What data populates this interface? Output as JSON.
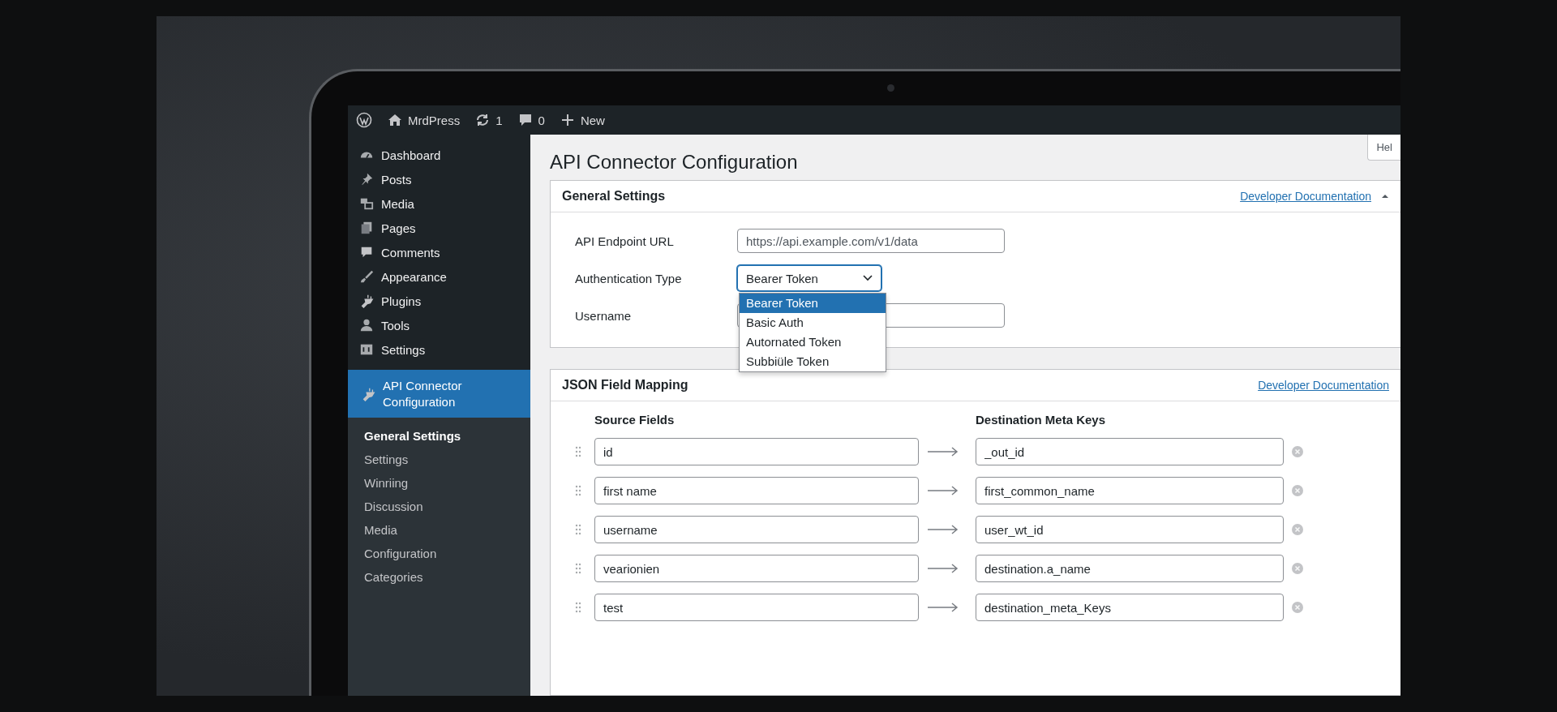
{
  "admin_bar": {
    "items": [
      {
        "kind": "logo"
      },
      {
        "kind": "home",
        "label": "MrdPress"
      },
      {
        "kind": "updates",
        "label": "1"
      },
      {
        "kind": "comments",
        "label": "0"
      },
      {
        "kind": "new",
        "label": "New"
      }
    ]
  },
  "sidebar": {
    "items": [
      {
        "kind": "dashboard",
        "label": "Dashboard",
        "selected": false
      },
      {
        "kind": "posts",
        "label": "Posts",
        "selected": false
      },
      {
        "kind": "media",
        "label": "Media",
        "selected": false
      },
      {
        "kind": "pages",
        "label": "Pages",
        "selected": false
      },
      {
        "kind": "comments",
        "label": "Comments",
        "selected": false
      },
      {
        "kind": "appearance",
        "label": "Appearance",
        "selected": false
      },
      {
        "kind": "plugins",
        "label": "Plugins",
        "selected": false
      },
      {
        "kind": "tools",
        "label": "Tools",
        "selected": false
      },
      {
        "kind": "settings",
        "label": "Settings",
        "selected": false
      },
      {
        "kind": "plugin",
        "label": "API Connector Configuration",
        "selected": true
      }
    ],
    "submenu": [
      {
        "label": "General Settings",
        "selected": true
      },
      {
        "label": "Settings",
        "selected": false
      },
      {
        "label": "Winriing",
        "selected": false
      },
      {
        "label": "Discussion",
        "selected": false
      },
      {
        "label": "Media",
        "selected": false
      },
      {
        "label": "Configuration",
        "selected": false
      },
      {
        "label": "Categories",
        "selected": false
      }
    ]
  },
  "page": {
    "title": "API Connector Configuration",
    "help_tab": "Hel"
  },
  "general_settings": {
    "title": "General Settings",
    "link": "Developer Documentation",
    "fields": [
      {
        "kind": "text",
        "label": "API Endpoint URL",
        "placeholder": "https://api.example.com/v1/data"
      },
      {
        "kind": "select",
        "label": "Authentication Type",
        "value": "Bearer Token",
        "expanded": true,
        "options": [
          {
            "label": "Bearer Token",
            "selected": true
          },
          {
            "label": "Basic Auth",
            "selected": false
          },
          {
            "label": "Autornated Token",
            "selected": false
          },
          {
            "label": "Subbiüle Token",
            "selected": false
          }
        ]
      },
      {
        "kind": "text",
        "label": "Username"
      }
    ]
  },
  "field_mapping": {
    "title": "JSON Field Mapping",
    "link": "Developer Documentation",
    "source_heading": "Source Fields",
    "destination_heading": "Destination Meta Keys",
    "rows": [
      {
        "source": "id",
        "destination": "_out_id"
      },
      {
        "source": "first name",
        "destination": "first_common_name"
      },
      {
        "source": "username",
        "destination": "user_wt_id"
      },
      {
        "source": "vearionien",
        "destination": "destination.a_name"
      },
      {
        "source": "test",
        "destination": "destination_meta_Keys"
      }
    ]
  }
}
